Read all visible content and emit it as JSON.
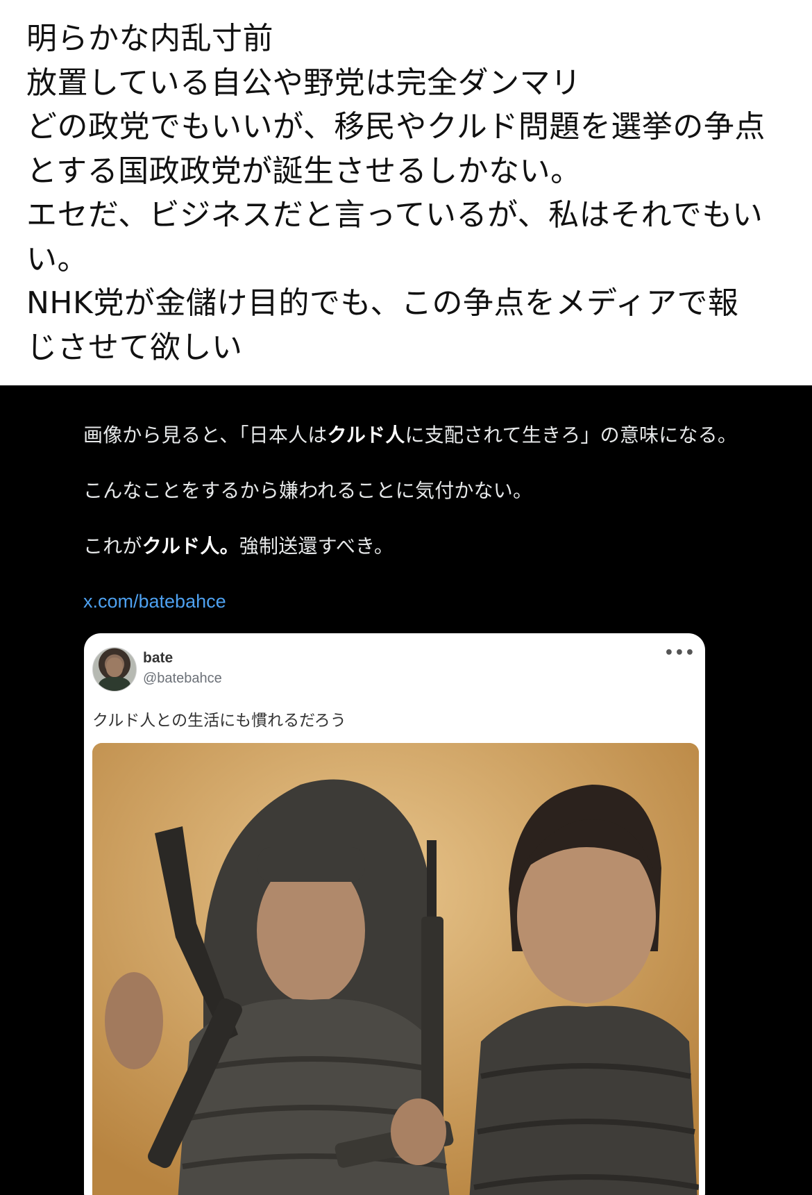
{
  "post": {
    "lines": [
      "明らかな内乱寸前",
      "放置している自公や野党は完全ダンマリ",
      "どの政党でもいいが、移民やクルド問題を選挙の争点",
      "とする国政政党が誕生させるしかない。",
      "エセだ、ビジネスだと言っているが、私はそれでもい",
      "い。",
      "NHK党が金儲け目的でも、この争点をメディアで報",
      "じさせて欲しい"
    ]
  },
  "embed": {
    "p1": {
      "a": "画像から見ると、「日本人は",
      "b": "クルド人",
      "c": "に支配されて生きろ」の意味になる。"
    },
    "p2": "こんなことをするから嫌われることに気付かない。",
    "p3": {
      "a": "これが",
      "b": "クルド人。",
      "c": "強制送還すべき。"
    },
    "link": "x.com/batebahce"
  },
  "quoted_tweet": {
    "display_name": "bate",
    "handle": "@batebahce",
    "more": "•••",
    "text": "クルド人との生活にも慣れるだろう"
  },
  "icons": {
    "avatar": "profile-avatar",
    "more": "more-options-icon"
  },
  "colors": {
    "embed_background": "#000000",
    "link": "#4ea1f0",
    "card_background": "#ffffff"
  }
}
